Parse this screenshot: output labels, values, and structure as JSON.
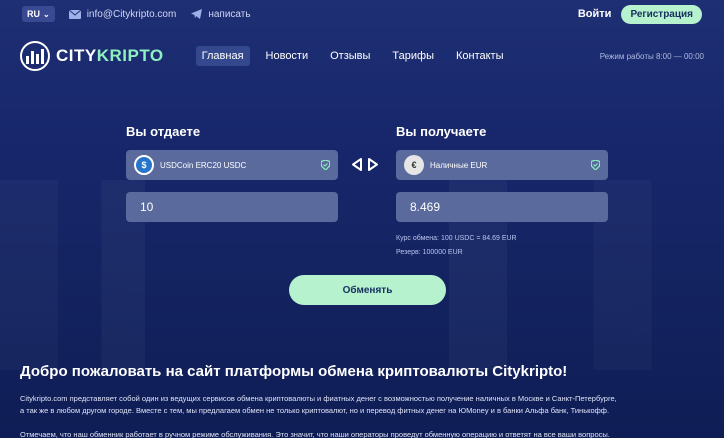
{
  "topbar": {
    "lang": "RU",
    "email": "info@Citykripto.com",
    "write_label": "написать",
    "login": "Войти",
    "register": "Регистрация"
  },
  "header": {
    "logo_part1": "CITY",
    "logo_part2": "KRIPTO",
    "nav": [
      "Главная",
      "Новости",
      "Отзывы",
      "Тарифы",
      "Контакты"
    ],
    "hours": "Режим работы 8:00 — 00:00"
  },
  "exchange": {
    "give_title": "Вы отдаете",
    "get_title": "Вы получаете",
    "give_currency": "USDCoin ERC20 USDC",
    "get_currency": "Наличные EUR",
    "give_amount": "10",
    "get_amount": "8.469",
    "rate": "Курс обмена: 100 USDC = 84.69 EUR",
    "reserve": "Резерв: 100000 EUR",
    "button": "Обменять"
  },
  "content": {
    "welcome": "Добро пожаловать на сайт платформы обмена криптовалюты Citykripto!",
    "para1_line1": "Citykripto.com представляет собой один из ведущих сервисов обмена криптовалюты и фиатных денег с возможностью получение наличных в Москве и Санкт-Петербурге,",
    "para1_line2": "а так же в любом другом городе. Вместе с тем, мы предлагаем обмен не только криптовалют, но и перевод фитных денег на ЮMoney и в банки Альфа банк, Тинькофф.",
    "para2": "Отмечаем, что наш обменник работает в ручном режиме обслуживания. Это значит, что наши операторы проведут обменную операцию и ответят на все ваши вопросы."
  },
  "colors": {
    "accent": "#b7f2cf",
    "field": "#5a6a9c",
    "background": "#1a2a6c"
  }
}
